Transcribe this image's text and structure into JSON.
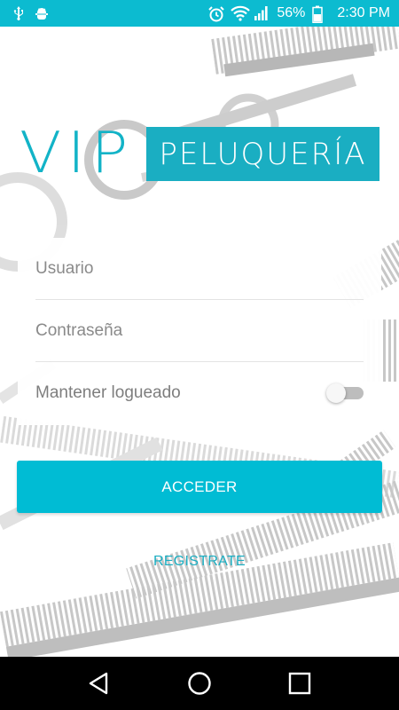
{
  "status_bar": {
    "battery_percent": "56%",
    "time": "2:30 PM",
    "left_icons": [
      "usb-icon",
      "android-debug-icon"
    ],
    "right_icons": [
      "alarm-icon",
      "wifi-icon",
      "signal-icon",
      "battery-icon"
    ]
  },
  "logo": {
    "primary": "VIP",
    "secondary": "PELUQUERÍA"
  },
  "form": {
    "username_placeholder": "Usuario",
    "username_value": "",
    "password_placeholder": "Contraseña",
    "password_value": "",
    "keep_logged_label": "Mantener logueado",
    "keep_logged_on": false
  },
  "actions": {
    "login_label": "ACCEDER",
    "register_label": "REGISTRATE"
  },
  "nav_bar": {
    "buttons": [
      "back-icon",
      "home-icon",
      "recents-icon"
    ]
  },
  "colors": {
    "accent": "#00bcd4",
    "logo_blue": "#1aaec2",
    "status_bar": "#0cbbd0"
  }
}
